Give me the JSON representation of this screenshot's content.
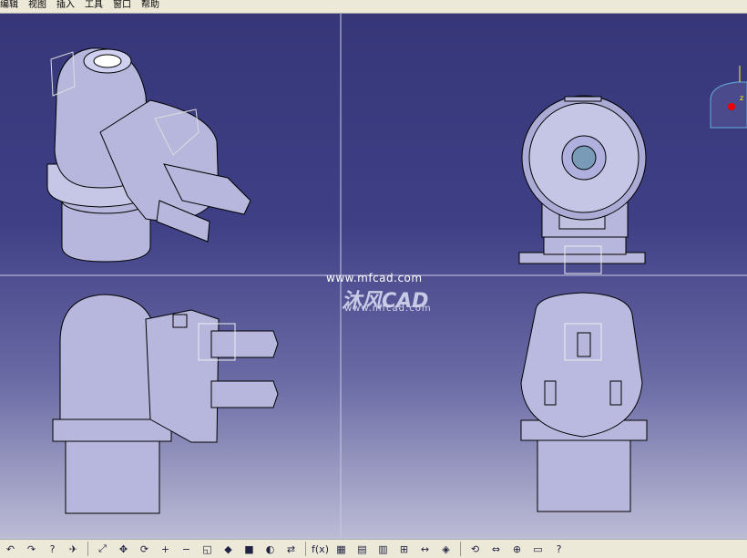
{
  "menu": {
    "items": [
      "编辑",
      "视图",
      "插入",
      "工具",
      "窗口",
      "帮助"
    ]
  },
  "watermark": {
    "url_top": "www.mfcad.com",
    "brand": "沐风CAD",
    "url_bottom": "www.mfcad.com"
  },
  "compass": {
    "axis_label": "z"
  },
  "toolbar": {
    "icons": [
      "undo-icon",
      "redo-icon",
      "whats-this-icon",
      "fly-icon",
      "fit-all-icon",
      "pan-icon",
      "rotate-icon",
      "zoom-in-icon",
      "zoom-out-icon",
      "normal-view-icon",
      "iso-view-icon",
      "shading-icon",
      "hide-show-icon",
      "swap-space-icon",
      "formula-icon",
      "design-table-icon",
      "parameters-icon",
      "table-icon",
      "hierarchy-icon",
      "measure-icon",
      "apply-material-icon",
      "update-icon",
      "measure-between-icon",
      "compass-icon",
      "capture-icon",
      "help-icon"
    ],
    "glyphs": [
      "↶",
      "↷",
      "?",
      "✈",
      "⤢",
      "✥",
      "⟳",
      "+",
      "−",
      "◱",
      "◆",
      "■",
      "◐",
      "⇄",
      "f(x)",
      "▦",
      "▤",
      "▥",
      "⊞",
      "↔",
      "◈",
      "⟲",
      "⇔",
      "⊕",
      "▭",
      "?"
    ]
  },
  "colors": {
    "background_top": "#363679",
    "background_bottom": "#bcbcd6",
    "part_fill": "#b7b7dd",
    "part_stroke": "#000000",
    "toolbar_bg": "#ece9d8"
  }
}
